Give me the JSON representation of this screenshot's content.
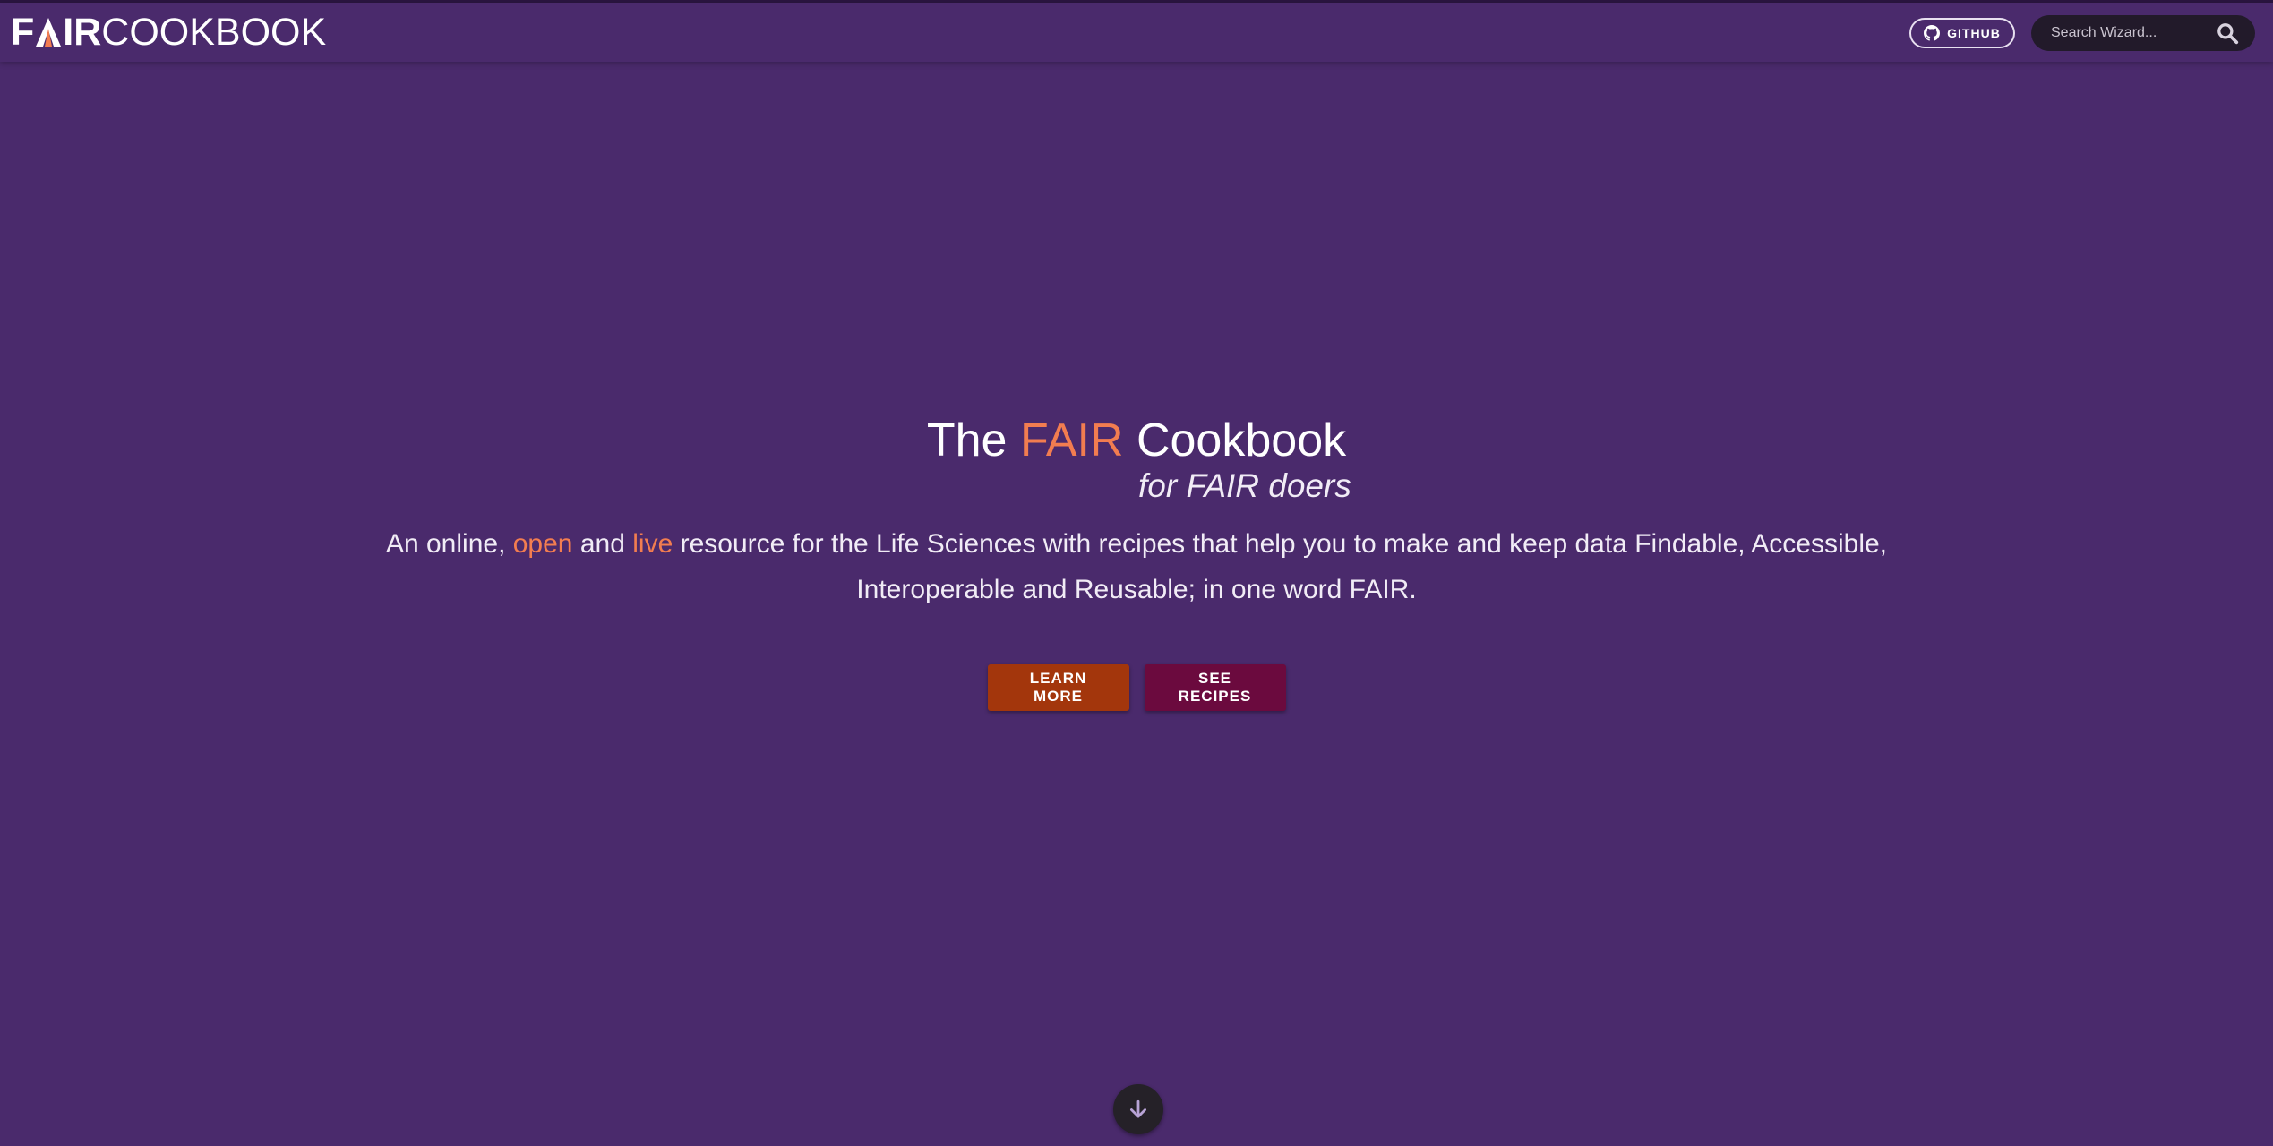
{
  "header": {
    "logo_fair_prefix": "F",
    "logo_fair_suffix": "IR",
    "logo_cookbook": "COOKBOOK",
    "github_label": "GITHUB",
    "search_placeholder": "Search Wizard...",
    "search_icon": "search-icon",
    "github_icon": "github-icon"
  },
  "hero": {
    "title_pre": "The ",
    "title_accent": "FAIR",
    "title_post": " Cookbook",
    "subtitle": "for FAIR doers",
    "desc_1": "An online, ",
    "desc_open": "open",
    "desc_2": " and ",
    "desc_live": "live",
    "desc_3": " resource for the Life Sciences with recipes that help you to make and keep data Findable, Accessible, Interoperable and Reusable; in one word FAIR.",
    "learn_more": "LEARN MORE",
    "see_recipes": "SEE RECIPES",
    "scroll_icon": "arrow-down-icon"
  },
  "colors": {
    "background": "#4a2a6c",
    "accent": "#f27d50",
    "learn_more_button": "#a3360c",
    "see_recipes_button": "#6b0a3e",
    "search_background": "#221a2a"
  }
}
